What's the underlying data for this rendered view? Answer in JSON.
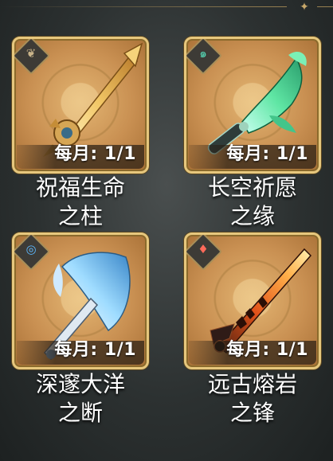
{
  "items": [
    {
      "limit_label": "每月: 1/1",
      "name_line1": "祝福生命",
      "name_line2": "之柱",
      "element": "dendro",
      "element_color": "#c9b48a",
      "icon": "golden-polearm-icon"
    },
    {
      "limit_label": "每月: 1/1",
      "name_line1": "长空祈愿",
      "name_line2": "之缘",
      "element": "anemo",
      "element_color": "#56d8b6",
      "icon": "jade-sword-icon"
    },
    {
      "limit_label": "每月: 1/1",
      "name_line1": "深邃大洋",
      "name_line2": "之断",
      "element": "hydro",
      "element_color": "#5cb8ff",
      "icon": "ocean-greatsword-icon"
    },
    {
      "limit_label": "每月: 1/1",
      "name_line1": "远古熔岩",
      "name_line2": "之锋",
      "element": "pyro",
      "element_color": "#ff6a5a",
      "icon": "lava-sword-icon"
    }
  ]
}
